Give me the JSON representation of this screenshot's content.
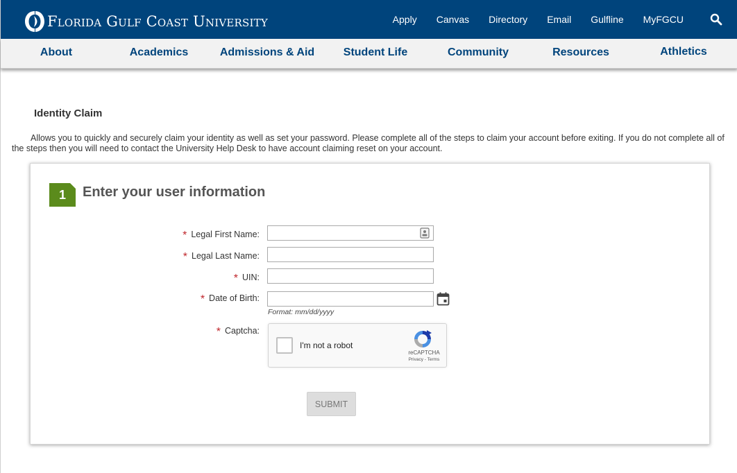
{
  "header": {
    "logo_text": "Florida Gulf Coast University",
    "links": [
      "Apply",
      "Canvas",
      "Directory",
      "Email",
      "Gulfline",
      "MyFGCU"
    ],
    "search_icon": "search-icon",
    "brand_color": "#00447c"
  },
  "nav": {
    "items": [
      "About",
      "Academics",
      "Admissions & Aid",
      "Student Life",
      "Community",
      "Resources",
      "Athletics"
    ]
  },
  "page": {
    "title": "Identity Claim",
    "intro": "Allows you to quickly and securely claim your identity as well as set your password. Please complete all of the steps to claim your account before exiting. If you do not complete all of the steps then you will need to contact the University Help Desk to have account claiming reset on your account."
  },
  "form": {
    "step_number": "1",
    "step_title": "Enter your user information",
    "step_color": "#5b8b1c",
    "required_mark": "*",
    "fields": {
      "first_name": {
        "label": "Legal First Name:",
        "value": ""
      },
      "last_name": {
        "label": "Legal Last Name:",
        "value": ""
      },
      "uin": {
        "label": "UIN:",
        "value": ""
      },
      "dob": {
        "label": "Date of Birth:",
        "value": "",
        "hint": "Format: mm/dd/yyyy"
      },
      "captcha": {
        "label": "Captcha:"
      }
    },
    "captcha": {
      "checkbox_text": "I'm not a robot",
      "brand": "reCAPTCHA",
      "terms": "Privacy - Terms"
    },
    "submit_label": "Submit"
  }
}
